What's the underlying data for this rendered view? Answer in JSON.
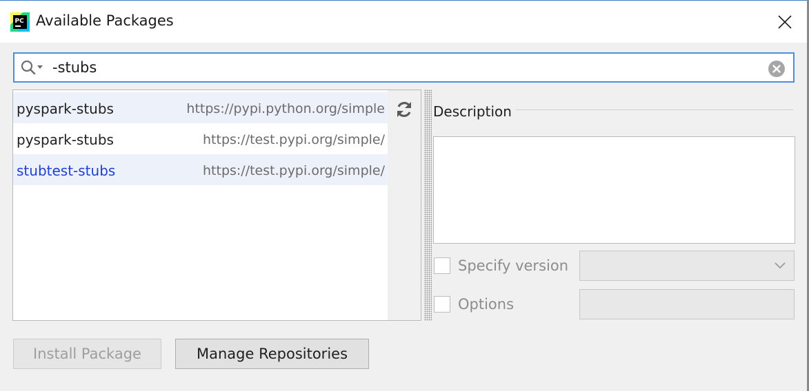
{
  "window": {
    "title": "Available Packages",
    "app_icon": "pycharm-icon",
    "app_icon_text": "PC",
    "close_icon": "close-icon"
  },
  "search": {
    "value": "-stubs",
    "icon": "search-icon",
    "clear_icon": "clear-icon"
  },
  "packages": [
    {
      "name": "pyspark-stubs",
      "repo": "https://pypi.python.org/simple"
    },
    {
      "name": "pyspark-stubs",
      "repo": "https://test.pypi.org/simple/"
    },
    {
      "name": "stubtest-stubs",
      "repo": "https://test.pypi.org/simple/"
    }
  ],
  "refresh_icon": "refresh-icon",
  "description": {
    "label": "Description",
    "text": ""
  },
  "options": {
    "specify_version_label": "Specify version",
    "specify_version_checked": false,
    "version_value": "",
    "options_label": "Options",
    "options_checked": false,
    "options_value": ""
  },
  "buttons": {
    "install": "Install Package",
    "manage": "Manage Repositories"
  },
  "colors": {
    "accent": "#4a90d9",
    "link": "#1e3fd6",
    "row_alt": "#edf2fa",
    "disabled_text": "#8c8c8c"
  }
}
